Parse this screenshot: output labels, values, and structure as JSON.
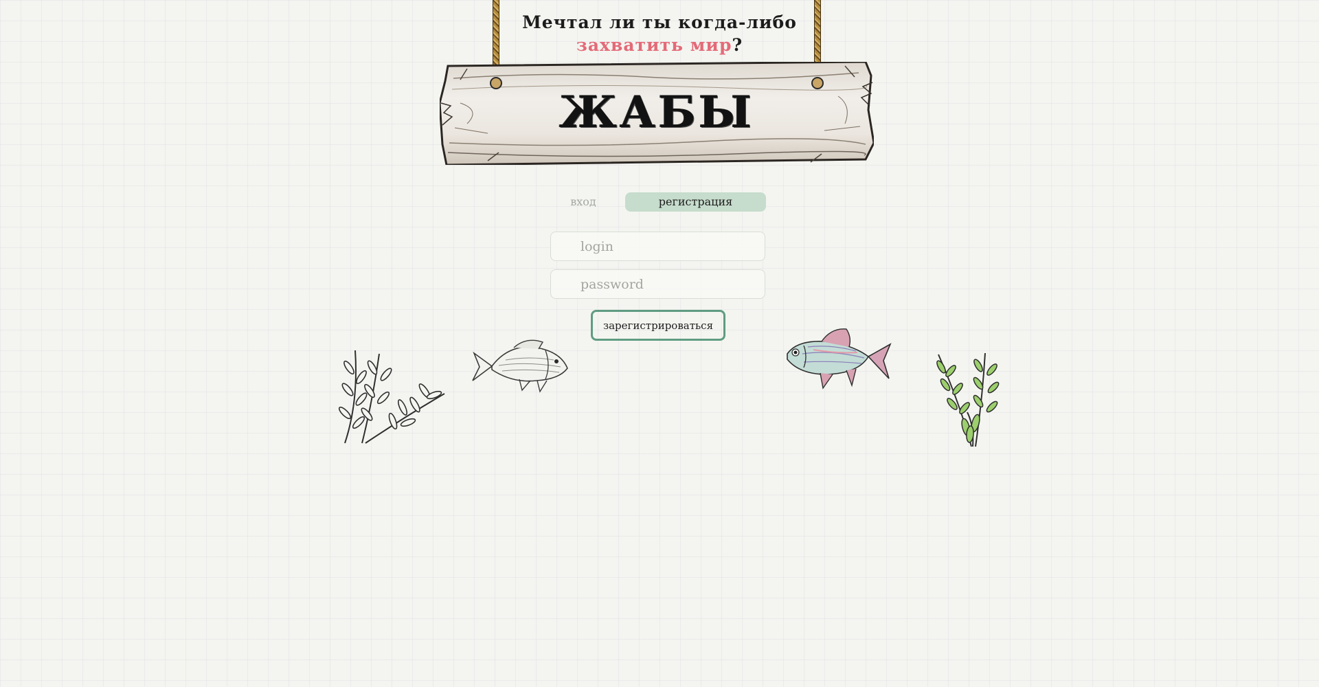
{
  "header": {
    "line1": "Мечтал ли ты когда-либо",
    "line2_accent": "захватить мир",
    "line2_tail": "?"
  },
  "sign": {
    "title": "ЖАБЫ"
  },
  "tabs": {
    "login_label": "вход",
    "register_label": "регистрация",
    "active": "регистрация"
  },
  "form": {
    "login_placeholder": "login",
    "password_placeholder": "password",
    "submit_label": "зарегистрироваться"
  },
  "colors": {
    "accent": "#e46a78",
    "active_tab_bg": "#c6dccc",
    "button_border": "#5f9c82",
    "background": "#f4f5f0"
  },
  "decorations": [
    "plant-left",
    "fish-grey",
    "fish-colored",
    "plant-right"
  ]
}
